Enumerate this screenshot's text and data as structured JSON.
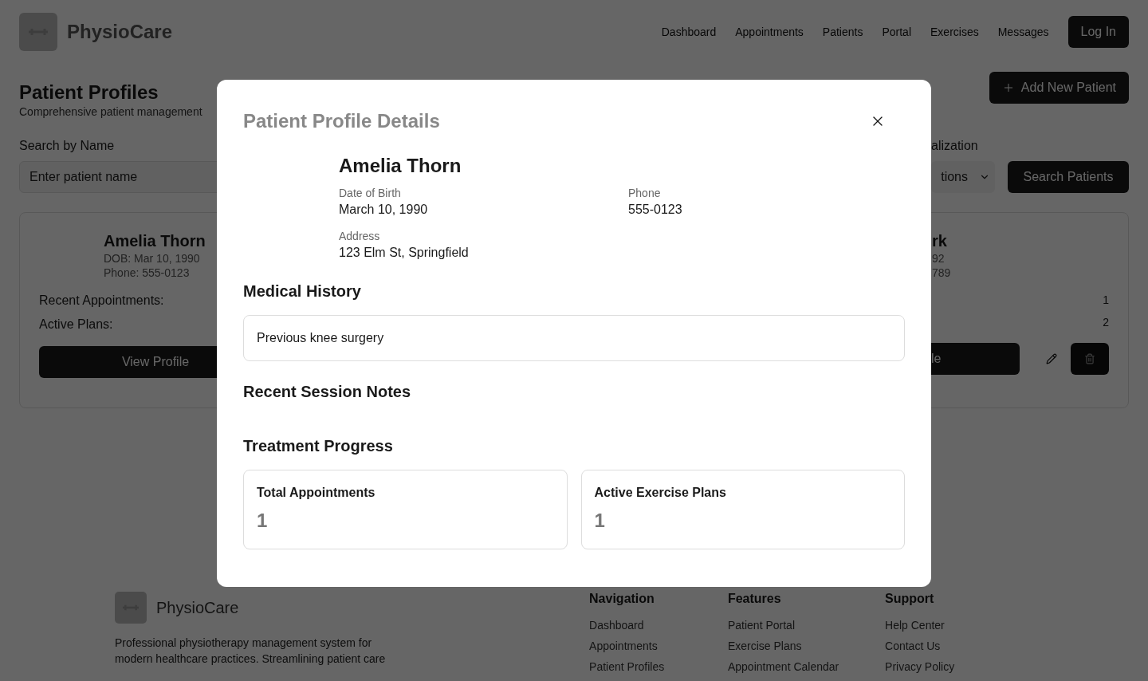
{
  "header": {
    "brand": "PhysioCare",
    "nav": [
      "Dashboard",
      "Appointments",
      "Patients",
      "Portal",
      "Exercises",
      "Messages"
    ],
    "login": "Log In"
  },
  "page": {
    "title": "Patient Profiles",
    "subtitle": "Comprehensive patient management",
    "add_button": "Add New Patient",
    "search": {
      "label": "Search by Name",
      "placeholder": "Enter patient name"
    },
    "filter": {
      "label": "alization",
      "value": "tions"
    },
    "search_button": "Search Patients",
    "cards": [
      {
        "name": "Amelia Thorn",
        "dob": "DOB: Mar 10, 1990",
        "phone": "Phone: 555-0123",
        "appointments_label": "Recent Appointments:",
        "plans_label": "Active Plans:",
        "button": "View Profile"
      },
      {
        "name": "rk",
        "dob": "92",
        "phone": "789",
        "appointments": "1",
        "plans": "2",
        "button": "le"
      }
    ]
  },
  "modal": {
    "title": "Patient Profile Details",
    "name": "Amelia Thorn",
    "fields": [
      {
        "label": "Date of Birth",
        "value": "March 10, 1990"
      },
      {
        "label": "Phone",
        "value": "555-0123"
      },
      {
        "label": "Address",
        "value": "123 Elm St, Springfield"
      }
    ],
    "sections": [
      {
        "heading": "Medical History",
        "text": "Previous knee surgery"
      },
      {
        "heading": "Recent Session Notes"
      },
      {
        "heading": "Treatment Progress"
      }
    ],
    "stats": [
      {
        "label": "Total Appointments",
        "value": "1"
      },
      {
        "label": "Active Exercise Plans",
        "value": "1"
      }
    ]
  },
  "footer": {
    "brand": "PhysioCare",
    "description": [
      "Professional physiotherapy management system for",
      "modern healthcare practices. Streamlining patient care"
    ],
    "columns": [
      {
        "heading": "Navigation",
        "links": [
          "Dashboard",
          "Appointments",
          "Patient Profiles"
        ]
      },
      {
        "heading": "Features",
        "links": [
          "Patient Portal",
          "Exercise Plans",
          "Appointment Calendar"
        ]
      },
      {
        "heading": "Support",
        "links": [
          "Help Center",
          "Contact Us",
          "Privacy Policy"
        ]
      }
    ]
  }
}
